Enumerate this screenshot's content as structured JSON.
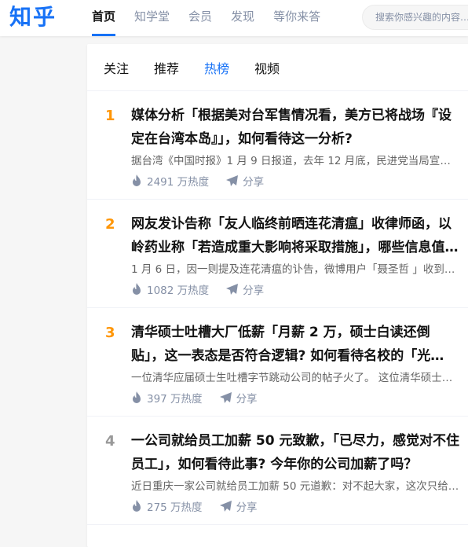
{
  "header": {
    "logo": "知乎",
    "brand_color": "#1772f6",
    "nav": [
      {
        "label": "首页",
        "active": true
      },
      {
        "label": "知学堂",
        "active": false
      },
      {
        "label": "会员",
        "active": false
      },
      {
        "label": "发现",
        "active": false
      },
      {
        "label": "等你来答",
        "active": false
      }
    ],
    "search_placeholder": "搜索你感兴趣的内容…"
  },
  "feed": {
    "tabs": [
      {
        "label": "关注",
        "active": false
      },
      {
        "label": "推荐",
        "active": false
      },
      {
        "label": "热榜",
        "active": true
      },
      {
        "label": "视频",
        "active": false
      }
    ],
    "items": [
      {
        "rank": "1",
        "rank_color": "#ff9607",
        "title": "媒体分析「根据美对台军售情况看，美方已将战场『设定在台湾本岛』」，如何看待这一分析?",
        "excerpt": "据台湾《中国时报》1 月 9 日报道，去年 12 月底，民进党当局宣布了一份军售清单...",
        "heat": "2491 万热度",
        "share": "分享"
      },
      {
        "rank": "2",
        "rank_color": "#ff9607",
        "title": "网友发讣告称「友人临终前晒连花清瘟」收律师函，以岭药业称「若造成重大影响将采取措施」，哪些信息值得关注？",
        "excerpt": "1 月 6 日，因一则提及连花清瘟的讣告，微博用户「聂圣哲 」收到以岭药业的律师函...",
        "heat": "1082 万热度",
        "share": "分享"
      },
      {
        "rank": "3",
        "rank_color": "#ff9607",
        "title": "清华硕士吐槽大厂低薪「月薪 2 万，硕士白读还倒贴」，这一表态是否符合逻辑? 如何看待名校的「光环」？",
        "excerpt": "一位清华应届硕士生吐槽字节跳动公司的帖子火了。 这位清华硕士表示月薪两万...",
        "heat": "397 万热度",
        "share": "分享"
      },
      {
        "rank": "4",
        "rank_color": "#999999",
        "title": "一公司就给员工加薪 50 元致歉，「已尽力，感觉对不住员工」，如何看待此事? 今年你的公司加薪了吗？",
        "excerpt": "近日重庆一家公司就给员工加薪 50 元道歉：对不起大家，这次只给大家加薪了 50 元...",
        "heat": "275 万热度",
        "share": "分享"
      }
    ]
  }
}
